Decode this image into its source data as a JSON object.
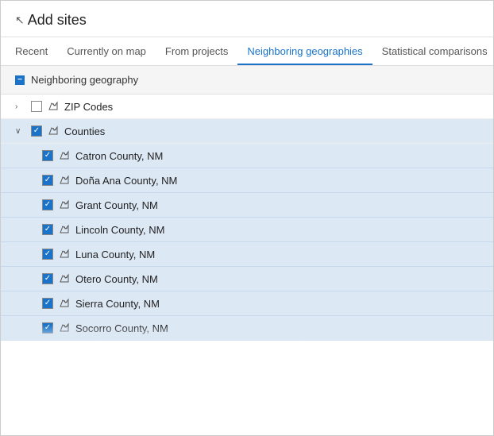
{
  "header": {
    "title": "Add sites"
  },
  "tabs": [
    {
      "id": "recent",
      "label": "Recent",
      "active": false
    },
    {
      "id": "currently-on-map",
      "label": "Currently on map",
      "active": false
    },
    {
      "id": "from-projects",
      "label": "From projects",
      "active": false
    },
    {
      "id": "neighboring-geographies",
      "label": "Neighboring geographies",
      "active": true
    },
    {
      "id": "statistical-comparisons",
      "label": "Statistical comparisons",
      "active": false
    }
  ],
  "section": {
    "title": "Neighboring geography"
  },
  "tree": {
    "groups": [
      {
        "id": "zip-codes",
        "label": "ZIP Codes",
        "expanded": false,
        "checked": false,
        "children": []
      },
      {
        "id": "counties",
        "label": "Counties",
        "expanded": true,
        "checked": true,
        "children": [
          {
            "id": "catron",
            "label": "Catron County, NM",
            "checked": true
          },
          {
            "id": "dona-ana",
            "label": "Doña Ana County, NM",
            "checked": true
          },
          {
            "id": "grant",
            "label": "Grant County, NM",
            "checked": true
          },
          {
            "id": "lincoln",
            "label": "Lincoln County, NM",
            "checked": true
          },
          {
            "id": "luna",
            "label": "Luna County, NM",
            "checked": true
          },
          {
            "id": "otero",
            "label": "Otero County, NM",
            "checked": true
          },
          {
            "id": "sierra",
            "label": "Sierra County, NM",
            "checked": true
          },
          {
            "id": "socorro",
            "label": "Socorro County, NM",
            "checked": true
          }
        ]
      }
    ]
  }
}
